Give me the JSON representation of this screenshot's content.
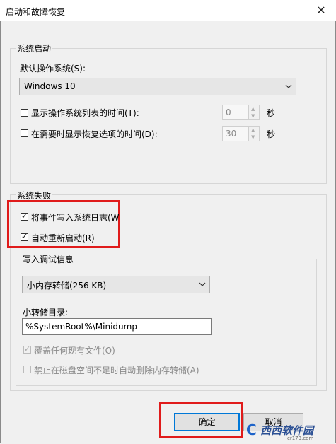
{
  "window": {
    "title": "启动和故障恢复",
    "close_symbol": "✕"
  },
  "system_startup": {
    "legend": "系统启动",
    "default_os_label": "默认操作系统(S):",
    "default_os_value": "Windows 10",
    "show_os_list": {
      "label": "显示操作系统列表的时间(T):",
      "checked": false,
      "value": "0",
      "unit": "秒"
    },
    "show_recovery": {
      "label": "在需要时显示恢复选项的时间(D):",
      "checked": false,
      "value": "30",
      "unit": "秒"
    }
  },
  "system_failure": {
    "legend": "系统失败",
    "write_event": {
      "label": "将事件写入系统日志(W)",
      "checked": true
    },
    "auto_restart": {
      "label": "自动重新启动(R)",
      "checked": true
    },
    "debug_info": {
      "legend": "写入调试信息",
      "dump_type": "小内存转储(256 KB)",
      "dir_label": "小转储目录:",
      "dir_value": "%SystemRoot%\\Minidump",
      "overwrite": {
        "label": "覆盖任何现有文件(O)",
        "checked": true
      },
      "disable_auto_delete": {
        "label": "禁止在磁盘空间不足时自动删除内存转储(A)",
        "checked": false
      }
    }
  },
  "buttons": {
    "ok": "确定",
    "cancel": "取消"
  },
  "watermark": {
    "text": "西西软件园",
    "subtext": "cr173.com"
  },
  "colors": {
    "highlight": "#e01b1b",
    "focus": "#0078d7"
  }
}
